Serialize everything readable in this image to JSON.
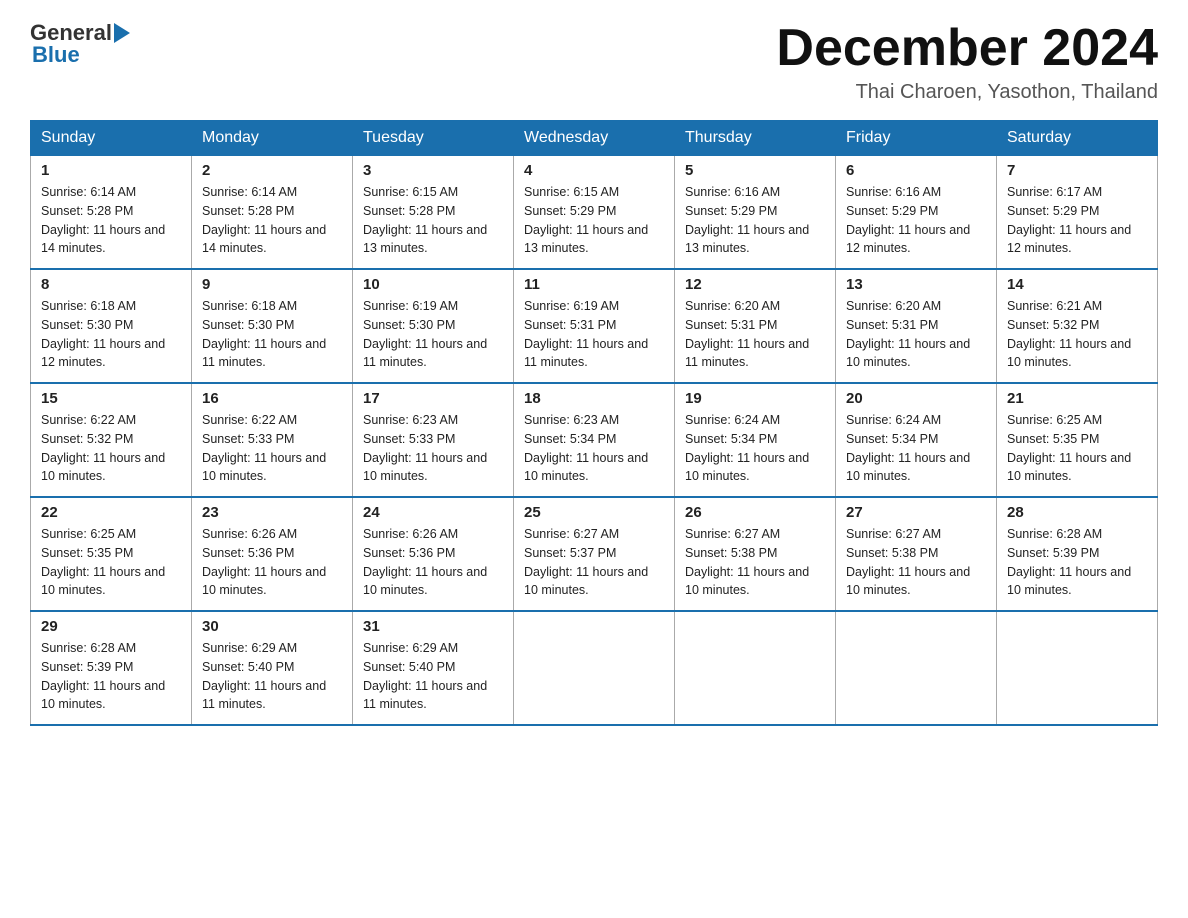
{
  "header": {
    "month_year": "December 2024",
    "location": "Thai Charoen, Yasothon, Thailand",
    "logo_general": "General",
    "logo_blue": "Blue"
  },
  "days_of_week": [
    "Sunday",
    "Monday",
    "Tuesday",
    "Wednesday",
    "Thursday",
    "Friday",
    "Saturday"
  ],
  "weeks": [
    [
      {
        "day": "1",
        "sunrise": "6:14 AM",
        "sunset": "5:28 PM",
        "daylight": "11 hours and 14 minutes."
      },
      {
        "day": "2",
        "sunrise": "6:14 AM",
        "sunset": "5:28 PM",
        "daylight": "11 hours and 14 minutes."
      },
      {
        "day": "3",
        "sunrise": "6:15 AM",
        "sunset": "5:28 PM",
        "daylight": "11 hours and 13 minutes."
      },
      {
        "day": "4",
        "sunrise": "6:15 AM",
        "sunset": "5:29 PM",
        "daylight": "11 hours and 13 minutes."
      },
      {
        "day": "5",
        "sunrise": "6:16 AM",
        "sunset": "5:29 PM",
        "daylight": "11 hours and 13 minutes."
      },
      {
        "day": "6",
        "sunrise": "6:16 AM",
        "sunset": "5:29 PM",
        "daylight": "11 hours and 12 minutes."
      },
      {
        "day": "7",
        "sunrise": "6:17 AM",
        "sunset": "5:29 PM",
        "daylight": "11 hours and 12 minutes."
      }
    ],
    [
      {
        "day": "8",
        "sunrise": "6:18 AM",
        "sunset": "5:30 PM",
        "daylight": "11 hours and 12 minutes."
      },
      {
        "day": "9",
        "sunrise": "6:18 AM",
        "sunset": "5:30 PM",
        "daylight": "11 hours and 11 minutes."
      },
      {
        "day": "10",
        "sunrise": "6:19 AM",
        "sunset": "5:30 PM",
        "daylight": "11 hours and 11 minutes."
      },
      {
        "day": "11",
        "sunrise": "6:19 AM",
        "sunset": "5:31 PM",
        "daylight": "11 hours and 11 minutes."
      },
      {
        "day": "12",
        "sunrise": "6:20 AM",
        "sunset": "5:31 PM",
        "daylight": "11 hours and 11 minutes."
      },
      {
        "day": "13",
        "sunrise": "6:20 AM",
        "sunset": "5:31 PM",
        "daylight": "11 hours and 10 minutes."
      },
      {
        "day": "14",
        "sunrise": "6:21 AM",
        "sunset": "5:32 PM",
        "daylight": "11 hours and 10 minutes."
      }
    ],
    [
      {
        "day": "15",
        "sunrise": "6:22 AM",
        "sunset": "5:32 PM",
        "daylight": "11 hours and 10 minutes."
      },
      {
        "day": "16",
        "sunrise": "6:22 AM",
        "sunset": "5:33 PM",
        "daylight": "11 hours and 10 minutes."
      },
      {
        "day": "17",
        "sunrise": "6:23 AM",
        "sunset": "5:33 PM",
        "daylight": "11 hours and 10 minutes."
      },
      {
        "day": "18",
        "sunrise": "6:23 AM",
        "sunset": "5:34 PM",
        "daylight": "11 hours and 10 minutes."
      },
      {
        "day": "19",
        "sunrise": "6:24 AM",
        "sunset": "5:34 PM",
        "daylight": "11 hours and 10 minutes."
      },
      {
        "day": "20",
        "sunrise": "6:24 AM",
        "sunset": "5:34 PM",
        "daylight": "11 hours and 10 minutes."
      },
      {
        "day": "21",
        "sunrise": "6:25 AM",
        "sunset": "5:35 PM",
        "daylight": "11 hours and 10 minutes."
      }
    ],
    [
      {
        "day": "22",
        "sunrise": "6:25 AM",
        "sunset": "5:35 PM",
        "daylight": "11 hours and 10 minutes."
      },
      {
        "day": "23",
        "sunrise": "6:26 AM",
        "sunset": "5:36 PM",
        "daylight": "11 hours and 10 minutes."
      },
      {
        "day": "24",
        "sunrise": "6:26 AM",
        "sunset": "5:36 PM",
        "daylight": "11 hours and 10 minutes."
      },
      {
        "day": "25",
        "sunrise": "6:27 AM",
        "sunset": "5:37 PM",
        "daylight": "11 hours and 10 minutes."
      },
      {
        "day": "26",
        "sunrise": "6:27 AM",
        "sunset": "5:38 PM",
        "daylight": "11 hours and 10 minutes."
      },
      {
        "day": "27",
        "sunrise": "6:27 AM",
        "sunset": "5:38 PM",
        "daylight": "11 hours and 10 minutes."
      },
      {
        "day": "28",
        "sunrise": "6:28 AM",
        "sunset": "5:39 PM",
        "daylight": "11 hours and 10 minutes."
      }
    ],
    [
      {
        "day": "29",
        "sunrise": "6:28 AM",
        "sunset": "5:39 PM",
        "daylight": "11 hours and 10 minutes."
      },
      {
        "day": "30",
        "sunrise": "6:29 AM",
        "sunset": "5:40 PM",
        "daylight": "11 hours and 11 minutes."
      },
      {
        "day": "31",
        "sunrise": "6:29 AM",
        "sunset": "5:40 PM",
        "daylight": "11 hours and 11 minutes."
      },
      null,
      null,
      null,
      null
    ]
  ],
  "labels": {
    "sunrise": "Sunrise:",
    "sunset": "Sunset:",
    "daylight": "Daylight:"
  }
}
